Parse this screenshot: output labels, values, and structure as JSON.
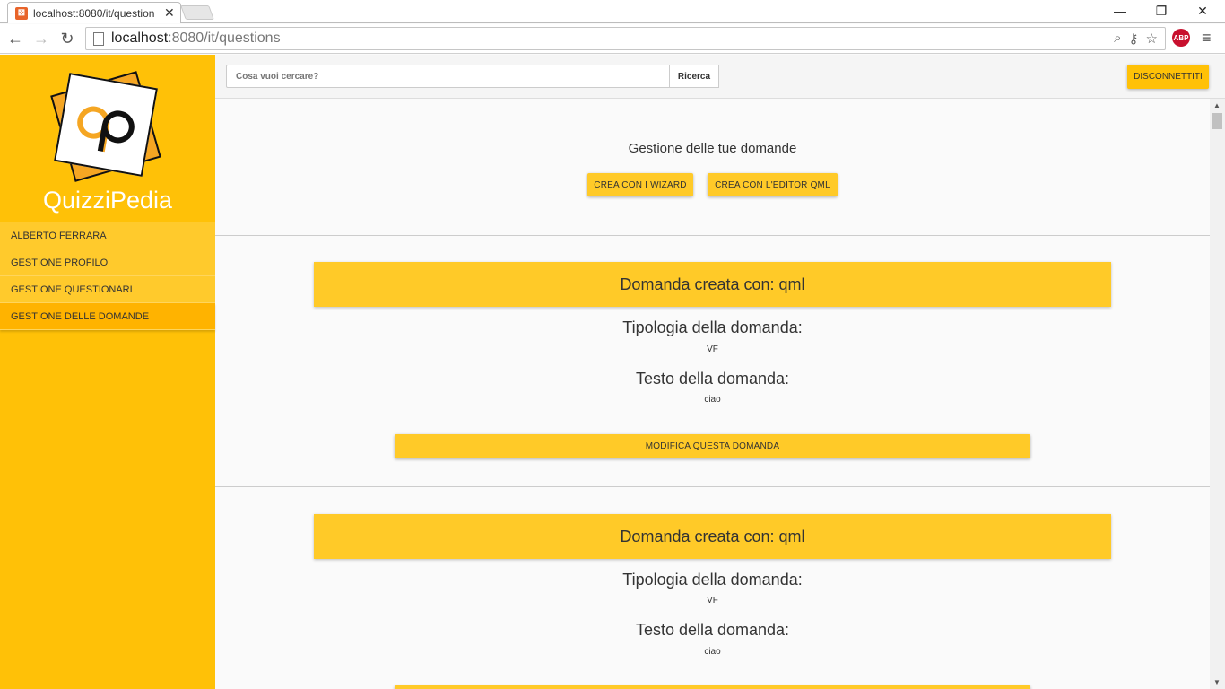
{
  "browser": {
    "tab_title": "localhost:8080/it/question",
    "tab_close": "✕",
    "url_host": "localhost",
    "url_path": ":8080/it/questions",
    "abp_label": "ABP",
    "win_minimize": "—",
    "win_restore": "❐",
    "win_close": "✕"
  },
  "sidebar": {
    "brand": "QuizziPedia",
    "items": [
      {
        "label": "ALBERTO FERRARA"
      },
      {
        "label": "GESTIONE PROFILO"
      },
      {
        "label": "GESTIONE QUESTIONARI"
      },
      {
        "label": "GESTIONE DELLE DOMANDE"
      }
    ]
  },
  "header": {
    "search_placeholder": "Cosa vuoi cercare?",
    "search_button": "Ricerca",
    "logout_button": "DISCONNETTITI"
  },
  "main": {
    "title": "Gestione delle tue domande",
    "wizard_button": "CREA CON I WIZARD",
    "qml_button": "CREA CON L'EDITOR QML",
    "questions": [
      {
        "header": "Domanda creata con: qml",
        "type_label": "Tipologia della domanda:",
        "type_value": "VF",
        "text_label": "Testo della domanda:",
        "text_value": "ciao",
        "edit_button": "MODIFICA QUESTA DOMANDA"
      },
      {
        "header": "Domanda creata con: qml",
        "type_label": "Tipologia della domanda:",
        "type_value": "VF",
        "text_label": "Testo della domanda:",
        "text_value": "ciao"
      }
    ]
  },
  "colors": {
    "sidebar": "#ffc107",
    "accent": "#ffca28"
  }
}
